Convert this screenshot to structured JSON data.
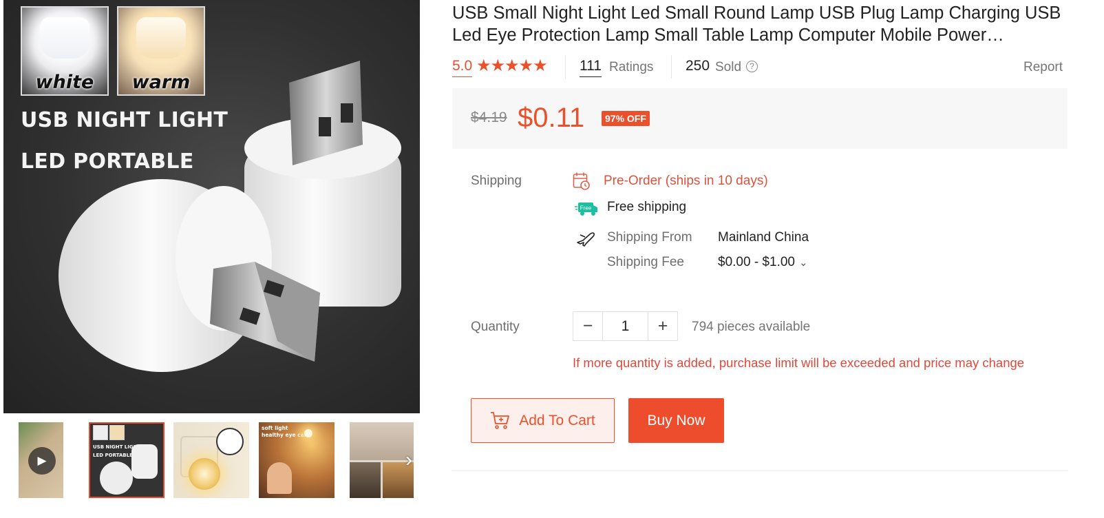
{
  "gallery": {
    "swatch_white": "white",
    "swatch_warm": "warm",
    "headline_1": "USB NIGHT LIGHT",
    "headline_2": "LED PORTABLE",
    "thumb_2_text_1": "USB NIGHT LIGHT",
    "thumb_2_text_2": "LED PORTABLE",
    "thumb_4_text_1": "soft light",
    "thumb_4_text_2": "healthy eye care"
  },
  "product": {
    "title": "USB Small Night Light Led Small Round Lamp USB Plug Lamp Charging USB Led Eye Protection Lamp Small Table Lamp Computer Mobile Power…"
  },
  "rating": {
    "score": "5.0",
    "stars": 5,
    "stars_glyph": "★★★★★",
    "ratings_count": "111",
    "ratings_label": "Ratings",
    "sold_count": "250",
    "sold_label": "Sold",
    "report_label": "Report"
  },
  "price": {
    "original": "$4.19",
    "current": "$0.11",
    "discount": "97% OFF"
  },
  "shipping": {
    "label": "Shipping",
    "preorder": "Pre-Order (ships in 10 days)",
    "free_badge": "Free",
    "free_shipping": "Free shipping",
    "from_label": "Shipping From",
    "from_value": "Mainland China",
    "fee_label": "Shipping Fee",
    "fee_value": "$0.00 - $1.00"
  },
  "quantity": {
    "label": "Quantity",
    "minus": "−",
    "plus": "+",
    "value": "1",
    "available": "794 pieces available",
    "limit_warning": "If more quantity is added, purchase limit will be exceeded and price may change"
  },
  "actions": {
    "add_to_cart": "Add To Cart",
    "buy_now": "Buy Now"
  },
  "colors": {
    "accent": "#ee4d2d",
    "accent_light": "#fdf0ec",
    "warning": "#e0483a"
  }
}
